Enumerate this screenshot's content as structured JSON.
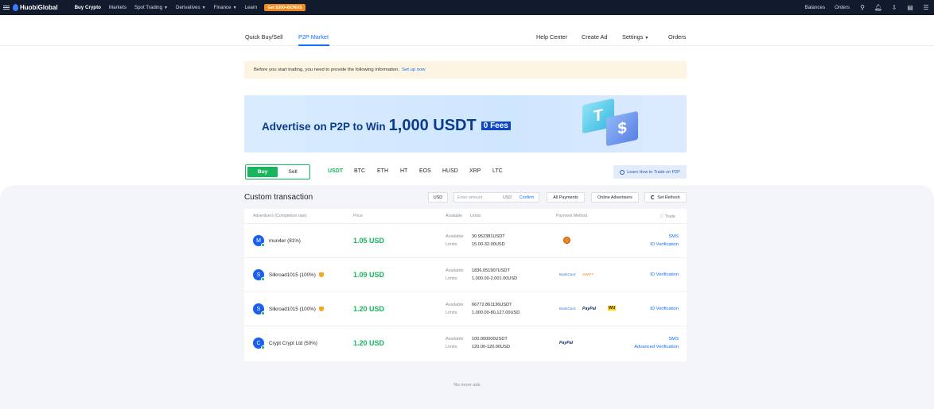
{
  "topbar": {
    "logo": "HuobiGlobal",
    "nav": [
      {
        "label": "Buy Crypto",
        "active": true,
        "caret": false
      },
      {
        "label": "Markets",
        "active": false,
        "caret": false
      },
      {
        "label": "Spot Trading",
        "active": false,
        "caret": true
      },
      {
        "label": "Derivatives",
        "active": false,
        "caret": true
      },
      {
        "label": "Finance",
        "active": false,
        "caret": true
      },
      {
        "label": "Learn",
        "active": false,
        "caret": false
      }
    ],
    "promo": "Get $300+BONUS",
    "right": {
      "balances": "Balances",
      "orders": "Orders"
    }
  },
  "subnav": {
    "quick_buy_sell": "Quick Buy/Sell",
    "p2p_market": "P2P Market",
    "help_center": "Help Center",
    "create_ad": "Create Ad",
    "settings": "Settings",
    "orders": "Orders"
  },
  "notice": {
    "text": "Before you start trading, you need to provide the following information.",
    "link": "Set up now"
  },
  "banner": {
    "text": "Advertise on P2P to Win",
    "amount": "1,000 USDT",
    "fees": "0 Fees"
  },
  "trade_side": {
    "buy": "Buy",
    "sell": "Sell",
    "selected": "Buy"
  },
  "coins": [
    "USDT",
    "BTC",
    "ETH",
    "HT",
    "EOS",
    "HUSD",
    "XRP",
    "LTC"
  ],
  "selected_coin": "USDT",
  "learn_button": "Learn How to Trade on P2P",
  "filters": {
    "title": "Custom transaction",
    "currency": "USD",
    "amount_placeholder": "Enter amount",
    "amount_unit": "USD",
    "confirm": "Confirm",
    "payments": "All Payments",
    "online": "Online Advertisers",
    "refresh": "Set Refresh"
  },
  "table": {
    "headers": {
      "advertisers": "Advertisers (Completion rate)",
      "price": "Price",
      "available": "Available",
      "limits": "Limits",
      "payment": "Payment Method",
      "trade": "Trade"
    },
    "available_label": "Available",
    "limits_label": "Limits",
    "rows": [
      {
        "initial": "M",
        "name": "mun4er (81%)",
        "badge": false,
        "price": "1.05 USD",
        "available": "30.952381USDT",
        "limits": "15.00-32.00USD",
        "trade1": "SMS",
        "trade2": "ID Verification"
      },
      {
        "initial": "S",
        "name": "Silkroad1015 (100%)",
        "badge": true,
        "price": "1.09 USD",
        "available": "1836.051907USDT",
        "limits": "1,000.00-2,001.00USD",
        "pay_bank": "BankCard",
        "pay_swift": "SWIFT",
        "trade1": "",
        "trade2": "ID Verification"
      },
      {
        "initial": "S",
        "name": "Silkroad1015 (100%)",
        "badge": true,
        "price": "1.20 USD",
        "available": "66772.861136USDT",
        "limits": "1,000.00-80,127.00USD",
        "pay_bank": "BankCard",
        "pay_paypal": "PayPal",
        "pay_wu": "WU",
        "trade1": "",
        "trade2": "ID Verification"
      },
      {
        "initial": "C",
        "name": "Crypt Crypt Ltd (50%)",
        "badge": false,
        "price": "1.20 USD",
        "available": "100.000000USDT",
        "limits": "120.00-120.00USD",
        "pay_paypal": "PayPal",
        "trade1": "SMS",
        "trade2": "Advanced Verification"
      }
    ]
  },
  "no_more": "No more ads"
}
